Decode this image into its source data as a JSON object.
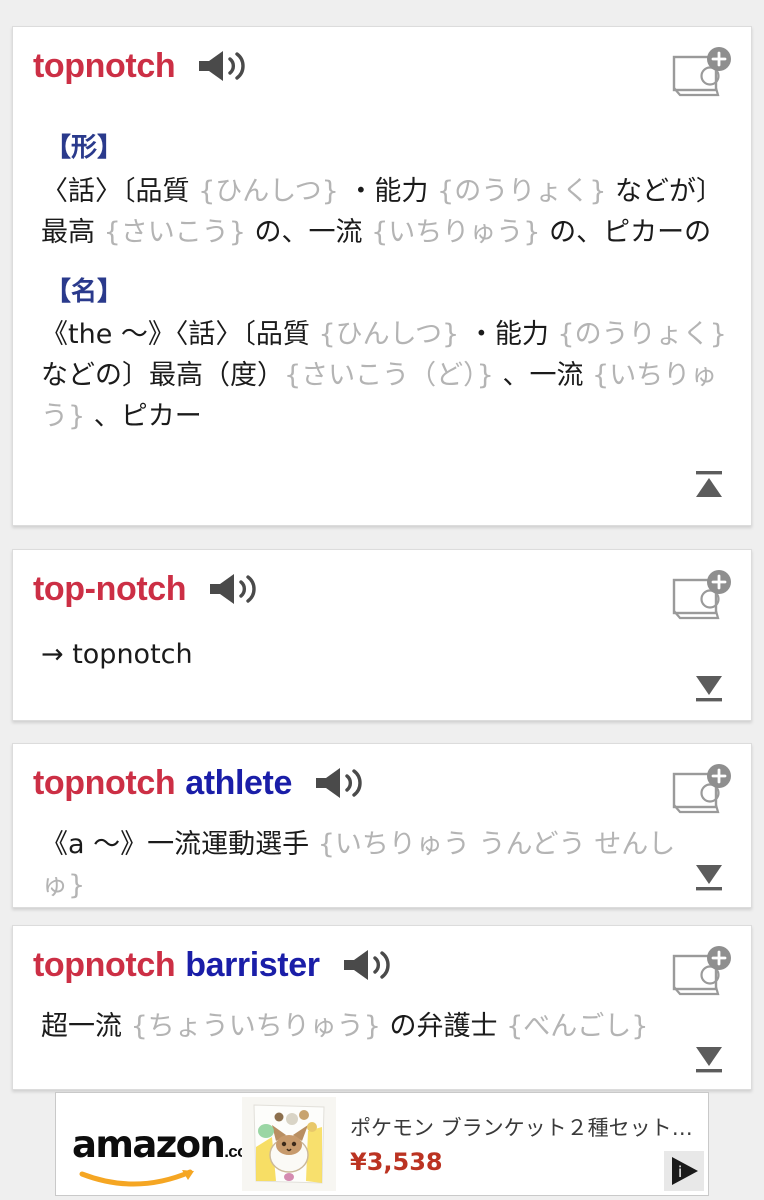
{
  "background_color": "#efefef",
  "colors": {
    "headword_red": "#cc2f45",
    "headword_blue": "#1a1ea8",
    "part_of_speech_blue": "#2a3a8c",
    "furigana_gray": "#b4b4b4",
    "body_text": "#1b1b1b",
    "price_red": "#bb3322"
  },
  "entries": [
    {
      "headword": "topnotch",
      "headword_secondary": "",
      "speaker_icon": "speaker-icon",
      "add_icon": "add-to-notebook-icon",
      "toggle_icon": "collapse-up-icon",
      "senses": [
        {
          "pos": "【形】",
          "parts": [
            {
              "text": "〈話〉〔品質 ",
              "style": "normal"
            },
            {
              "text": "{ひんしつ}",
              "style": "furigana"
            },
            {
              "text": " ・能力 ",
              "style": "normal"
            },
            {
              "text": "{のうりょく}",
              "style": "furigana"
            },
            {
              "text": " などが〕最高 ",
              "style": "normal"
            },
            {
              "text": "{さいこう}",
              "style": "furigana"
            },
            {
              "text": " の、一流 ",
              "style": "normal"
            },
            {
              "text": "{いちりゅう}",
              "style": "furigana"
            },
            {
              "text": " の、ピカーの",
              "style": "normal"
            }
          ]
        },
        {
          "pos": "【名】",
          "parts": [
            {
              "text": "《the ～》〈話〉〔品質 ",
              "style": "normal"
            },
            {
              "text": "{ひんしつ}",
              "style": "furigana"
            },
            {
              "text": " ・能力 ",
              "style": "normal"
            },
            {
              "text": "{のうりょく}",
              "style": "furigana"
            },
            {
              "text": " などの〕最高（度）",
              "style": "normal"
            },
            {
              "text": "{さいこう（ど）}",
              "style": "furigana"
            },
            {
              "text": " 、一流 ",
              "style": "normal"
            },
            {
              "text": "{いちりゅう}",
              "style": "furigana"
            },
            {
              "text": " 、ピカー",
              "style": "normal"
            }
          ]
        }
      ]
    },
    {
      "headword": "top-notch",
      "headword_secondary": "",
      "speaker_icon": "speaker-icon",
      "add_icon": "add-to-notebook-icon",
      "toggle_icon": "expand-down-icon",
      "senses": [
        {
          "pos": "",
          "parts": [
            {
              "text": "→ topnotch",
              "style": "normal"
            }
          ]
        }
      ]
    },
    {
      "headword": "topnotch",
      "headword_secondary": "athlete",
      "speaker_icon": "speaker-icon",
      "add_icon": "add-to-notebook-icon",
      "toggle_icon": "expand-down-icon",
      "senses": [
        {
          "pos": "",
          "parts": [
            {
              "text": "《a ～》一流運動選手 ",
              "style": "normal"
            },
            {
              "text": "{いちりゅう うんどう せんしゅ}",
              "style": "furigana"
            }
          ]
        }
      ]
    },
    {
      "headword": "topnotch",
      "headword_secondary": "barrister",
      "speaker_icon": "speaker-icon",
      "add_icon": "add-to-notebook-icon",
      "toggle_icon": "expand-down-icon",
      "senses": [
        {
          "pos": "",
          "parts": [
            {
              "text": "超一流 ",
              "style": "normal"
            },
            {
              "text": "{ちょういちりゅう}",
              "style": "furigana"
            },
            {
              "text": " の弁護士 ",
              "style": "normal"
            },
            {
              "text": "{べんごし}",
              "style": "furigana"
            }
          ]
        }
      ]
    }
  ],
  "ad": {
    "brand": "amazon",
    "brand_suffix": ".co.jp",
    "thumbnail_alt": "pokemon-blanket-product-photo",
    "title": "ポケモン ブランケット２種セット …",
    "price": "¥3,538",
    "adchoices_icon": "adchoices-icon"
  }
}
